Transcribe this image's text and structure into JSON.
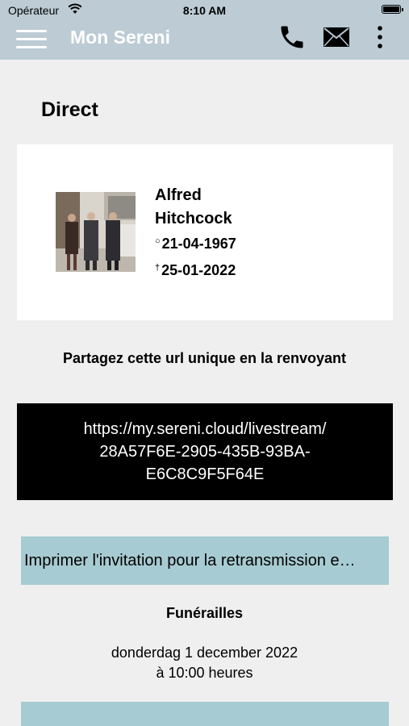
{
  "status_bar": {
    "carrier": "Opérateur",
    "time": "8:10 AM"
  },
  "nav": {
    "title": "Mon Sereni",
    "menu_icon": "hamburger-menu-icon",
    "phone_icon": "phone-icon",
    "mail_icon": "envelope-icon",
    "more_icon": "vertical-dots-icon"
  },
  "page": {
    "heading": "Direct"
  },
  "person": {
    "first_name": "Alfred",
    "last_name": "Hitchcock",
    "born_symbol": "○",
    "born": "21-04-1967",
    "died_symbol": "†",
    "died": "25-01-2022"
  },
  "share": {
    "label": "Partagez cette url unique en la renvoyant",
    "url_line1": "https://my.sereni.cloud/livestream/",
    "url_line2": "28A57F6E-2905-435B-93BA-",
    "url_line3": "E6C8C9F5F64E"
  },
  "print_button": {
    "label": "Imprimer l'invitation pour la retransmission e…"
  },
  "event": {
    "title": "Funérailles",
    "date": "donderdag 1 december 2022",
    "time": "à 10:00 heures"
  },
  "colors": {
    "bar": "#bccbd4",
    "background": "#efefef",
    "button": "#a7cbd2",
    "url_box": "#000000"
  }
}
